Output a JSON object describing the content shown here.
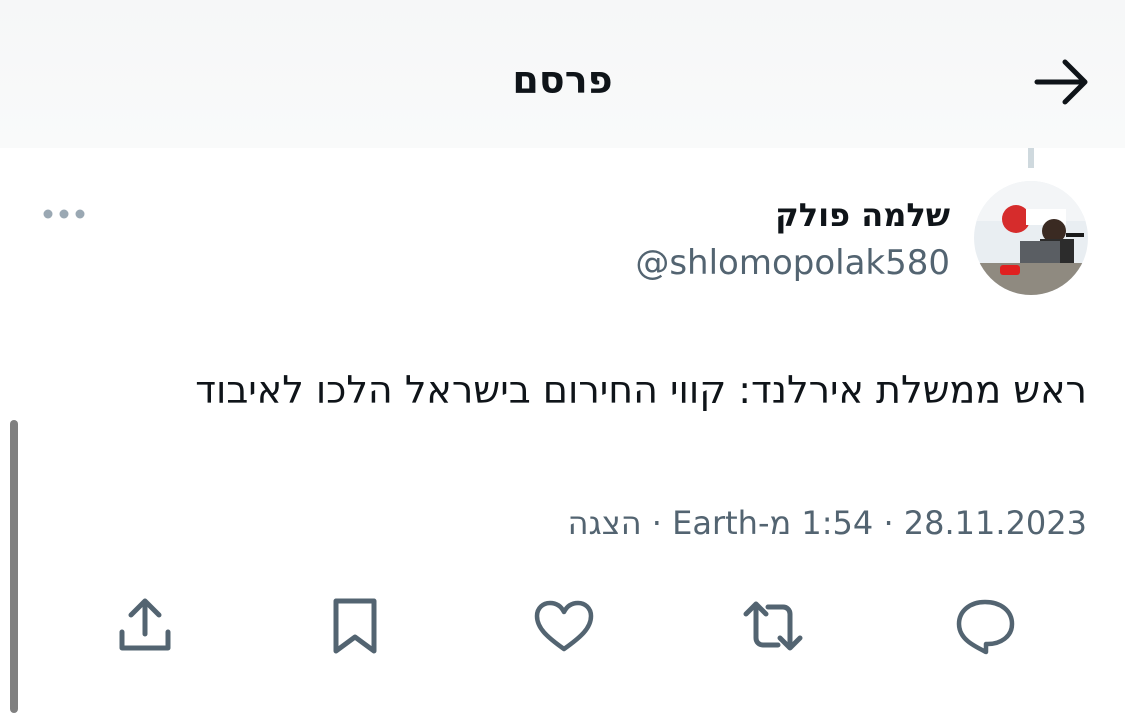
{
  "header": {
    "title": "פרסם",
    "back_icon": "arrow-right-icon"
  },
  "author": {
    "display_name": "שלמה פולק",
    "handle": "@shlomopolak580",
    "avatar": "avatar-photo"
  },
  "tweet": {
    "text": "ראש ממשלת אירלנד: קווי החירום בישראל הלכו לאיבוד",
    "date": "28.11.2023",
    "time_source": "1:54 מ-Earth",
    "views_label": "הצגה",
    "separator": "·"
  },
  "actions": [
    {
      "name": "reply",
      "icon": "comment-icon"
    },
    {
      "name": "retweet",
      "icon": "retweet-icon"
    },
    {
      "name": "like",
      "icon": "heart-icon"
    },
    {
      "name": "bookmark",
      "icon": "bookmark-icon"
    },
    {
      "name": "share",
      "icon": "share-icon"
    }
  ],
  "colors": {
    "text": "#0f1419",
    "secondary": "#536471",
    "header_bg": "#f7f8f9"
  }
}
